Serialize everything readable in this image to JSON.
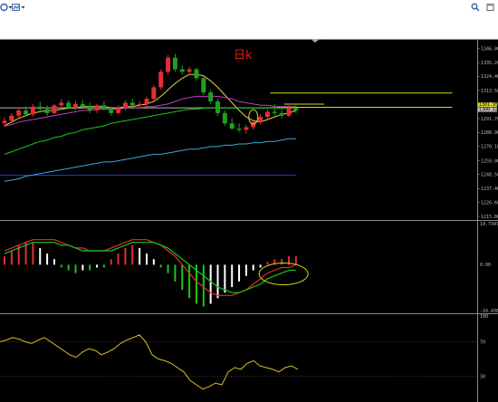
{
  "toolbar": {
    "left_icons": [
      "refresh-icon",
      "dropdown-icon",
      "chart-icon",
      "dropdown-icon"
    ],
    "right_icons": [
      "search-icon",
      "window-icon"
    ]
  },
  "chart_data": [
    {
      "type": "candlestick",
      "title": "日k",
      "y_ticks": [
        "1346.00",
        "1335.20",
        "1324.40",
        "1313.50",
        "1302.90",
        "1291.70",
        "1280.90",
        "1270.10",
        "1259.00",
        "1248.50",
        "1237.40",
        "1226.60",
        "1215.80"
      ],
      "ylim": [
        1213,
        1350
      ],
      "price_tags": [
        "1301.95",
        "1300.52"
      ],
      "up_color": "#e03030",
      "down_color": "#1fa01f",
      "candles": [
        [
          1288,
          1293,
          1285,
          1290
        ],
        [
          1290,
          1296,
          1288,
          1294
        ],
        [
          1294,
          1300,
          1292,
          1298
        ],
        [
          1298,
          1301,
          1293,
          1295
        ],
        [
          1295,
          1303,
          1293,
          1301
        ],
        [
          1301,
          1305,
          1297,
          1299
        ],
        [
          1299,
          1302,
          1294,
          1296
        ],
        [
          1296,
          1303,
          1295,
          1302
        ],
        [
          1302,
          1307,
          1299,
          1304
        ],
        [
          1304,
          1306,
          1299,
          1300
        ],
        [
          1300,
          1305,
          1298,
          1303
        ],
        [
          1303,
          1306,
          1299,
          1301
        ],
        [
          1301,
          1304,
          1296,
          1298
        ],
        [
          1298,
          1303,
          1296,
          1302
        ],
        [
          1302,
          1305,
          1298,
          1299
        ],
        [
          1299,
          1301,
          1294,
          1296
        ],
        [
          1296,
          1302,
          1295,
          1300
        ],
        [
          1300,
          1306,
          1298,
          1304
        ],
        [
          1304,
          1307,
          1299,
          1302
        ],
        [
          1302,
          1305,
          1300,
          1303
        ],
        [
          1303,
          1309,
          1301,
          1307
        ],
        [
          1307,
          1318,
          1305,
          1316
        ],
        [
          1316,
          1330,
          1314,
          1328
        ],
        [
          1328,
          1341,
          1326,
          1339
        ],
        [
          1339,
          1342,
          1328,
          1330
        ],
        [
          1330,
          1333,
          1326,
          1328
        ],
        [
          1328,
          1332,
          1325,
          1330
        ],
        [
          1330,
          1331,
          1321,
          1323
        ],
        [
          1323,
          1325,
          1310,
          1312
        ],
        [
          1312,
          1314,
          1303,
          1305
        ],
        [
          1305,
          1307,
          1294,
          1296
        ],
        [
          1296,
          1298,
          1286,
          1288
        ],
        [
          1288,
          1292,
          1283,
          1284
        ],
        [
          1284,
          1288,
          1281,
          1283
        ],
        [
          1283,
          1287,
          1280,
          1285
        ],
        [
          1285,
          1291,
          1283,
          1289
        ],
        [
          1289,
          1295,
          1287,
          1293
        ],
        [
          1293,
          1299,
          1290,
          1297
        ],
        [
          1297,
          1303,
          1294,
          1296
        ],
        [
          1296,
          1301,
          1292,
          1294
        ],
        [
          1294,
          1302,
          1293,
          1300
        ],
        [
          1300,
          1302,
          1296,
          1298
        ]
      ],
      "ma_series": [
        {
          "color": "#e8d14a",
          "values": [
            1286,
            1289,
            1292,
            1294,
            1296,
            1297,
            1298,
            1298,
            1299,
            1300,
            1300,
            1301,
            1301,
            1301,
            1301,
            1300,
            1300,
            1301,
            1301,
            1302,
            1303,
            1305,
            1309,
            1314,
            1319,
            1323,
            1326,
            1326,
            1325,
            1321,
            1316,
            1310,
            1304,
            1298,
            1293,
            1290,
            1289,
            1291,
            1293,
            1295,
            1296,
            1298
          ]
        },
        {
          "color": "#c040c0",
          "values": [
            1286,
            1287,
            1289,
            1290,
            1291,
            1292,
            1293,
            1294,
            1295,
            1296,
            1297,
            1298,
            1298,
            1299,
            1299,
            1299,
            1299,
            1300,
            1300,
            1300,
            1301,
            1301,
            1302,
            1303,
            1305,
            1307,
            1308,
            1309,
            1309,
            1309,
            1309,
            1308,
            1307,
            1305,
            1304,
            1303,
            1302,
            1302,
            1301,
            1301,
            1301,
            1301
          ]
        },
        {
          "color": "#18c818",
          "values": [
            1264,
            1266,
            1268,
            1270,
            1272,
            1274,
            1275,
            1277,
            1278,
            1280,
            1281,
            1283,
            1284,
            1285,
            1286,
            1288,
            1289,
            1290,
            1291,
            1292,
            1293,
            1294,
            1295,
            1296,
            1297,
            1298,
            1299,
            1299,
            1300,
            1300,
            1300,
            1300,
            1300,
            1300,
            1300,
            1300,
            1300,
            1300,
            1300,
            1300,
            1300,
            1301
          ]
        },
        {
          "color": "#3aa8d8",
          "values": [
            1243,
            1244,
            1245,
            1247,
            1248,
            1249,
            1250,
            1251,
            1252,
            1253,
            1254,
            1255,
            1256,
            1257,
            1258,
            1258,
            1259,
            1260,
            1261,
            1262,
            1263,
            1264,
            1264,
            1265,
            1266,
            1267,
            1268,
            1268,
            1269,
            1270,
            1270,
            1271,
            1271,
            1272,
            1272,
            1273,
            1273,
            1274,
            1274,
            1275,
            1276,
            1276
          ]
        }
      ],
      "horizontal_lines": [
        {
          "value": 1247.8,
          "color": "#1a3ad8",
          "x_start": 0,
          "x_end": 41
        },
        {
          "value": 1311.5,
          "color": "#d8d820",
          "x_start": 38,
          "x_end": 63
        },
        {
          "value": 1302.9,
          "color": "#d8d820",
          "x_start": 40,
          "x_end": 45
        },
        {
          "value": 1300.5,
          "color": "#d8d820",
          "x_start": 39,
          "x_end": 63
        },
        {
          "value": 1300.0,
          "color": "#b8b8b8",
          "x_start": 0,
          "x_end": 41
        }
      ],
      "annotation": {
        "type": "ellipse",
        "bar_index": 35,
        "value": 1293
      }
    },
    {
      "type": "macd",
      "y_ticks": [
        "14.7347",
        "0.00",
        "-16.436"
      ],
      "ylim": [
        -16.436,
        14.7347
      ],
      "histogram": [
        3,
        5,
        7,
        8,
        8,
        6,
        4,
        2,
        -1,
        -2,
        -3,
        -2,
        -2,
        -1,
        -1,
        2,
        4,
        6,
        7,
        6,
        4,
        2,
        -1,
        -3,
        -6,
        -9,
        -12,
        -14,
        -15,
        -14,
        -12,
        -10,
        -8,
        -6,
        -4,
        -2,
        -1,
        1,
        2,
        2,
        3,
        3
      ],
      "dif": [
        5,
        6,
        7,
        8,
        9,
        9,
        9,
        9,
        8,
        7,
        6,
        6,
        5,
        5,
        5,
        6,
        7,
        8,
        9,
        9,
        9,
        8,
        7,
        5,
        3,
        0,
        -3,
        -6,
        -8,
        -10,
        -11,
        -11,
        -11,
        -10,
        -9,
        -7,
        -5,
        -3,
        -2,
        -1,
        -1,
        0
      ],
      "dea": [
        4,
        5,
        6,
        7,
        8,
        8,
        8,
        8,
        7,
        7,
        6,
        5,
        5,
        5,
        5,
        5,
        6,
        7,
        8,
        8,
        8,
        8,
        7,
        6,
        4,
        2,
        0,
        -2,
        -4,
        -6,
        -8,
        -9,
        -10,
        -10,
        -9,
        -8,
        -7,
        -5,
        -4,
        -3,
        -2,
        -2
      ],
      "up_color": "#e03030",
      "down_color": "#18c818",
      "dif_color": "#e03030",
      "dea_color": "#18c818",
      "annotation": {
        "type": "ellipse",
        "bar_index": 39,
        "value": -2
      }
    },
    {
      "type": "oscillator",
      "y_ticks": [
        "100",
        "70",
        "30"
      ],
      "ylim": [
        0,
        100
      ],
      "color": "#d8c020",
      "values": [
        70,
        72,
        75,
        73,
        70,
        68,
        72,
        75,
        70,
        65,
        60,
        55,
        52,
        58,
        62,
        60,
        55,
        58,
        62,
        68,
        72,
        75,
        78,
        70,
        55,
        50,
        48,
        45,
        40,
        35,
        25,
        20,
        15,
        18,
        22,
        20,
        35,
        40,
        38,
        45,
        48,
        42,
        40,
        38,
        35,
        40,
        42,
        38
      ]
    }
  ]
}
